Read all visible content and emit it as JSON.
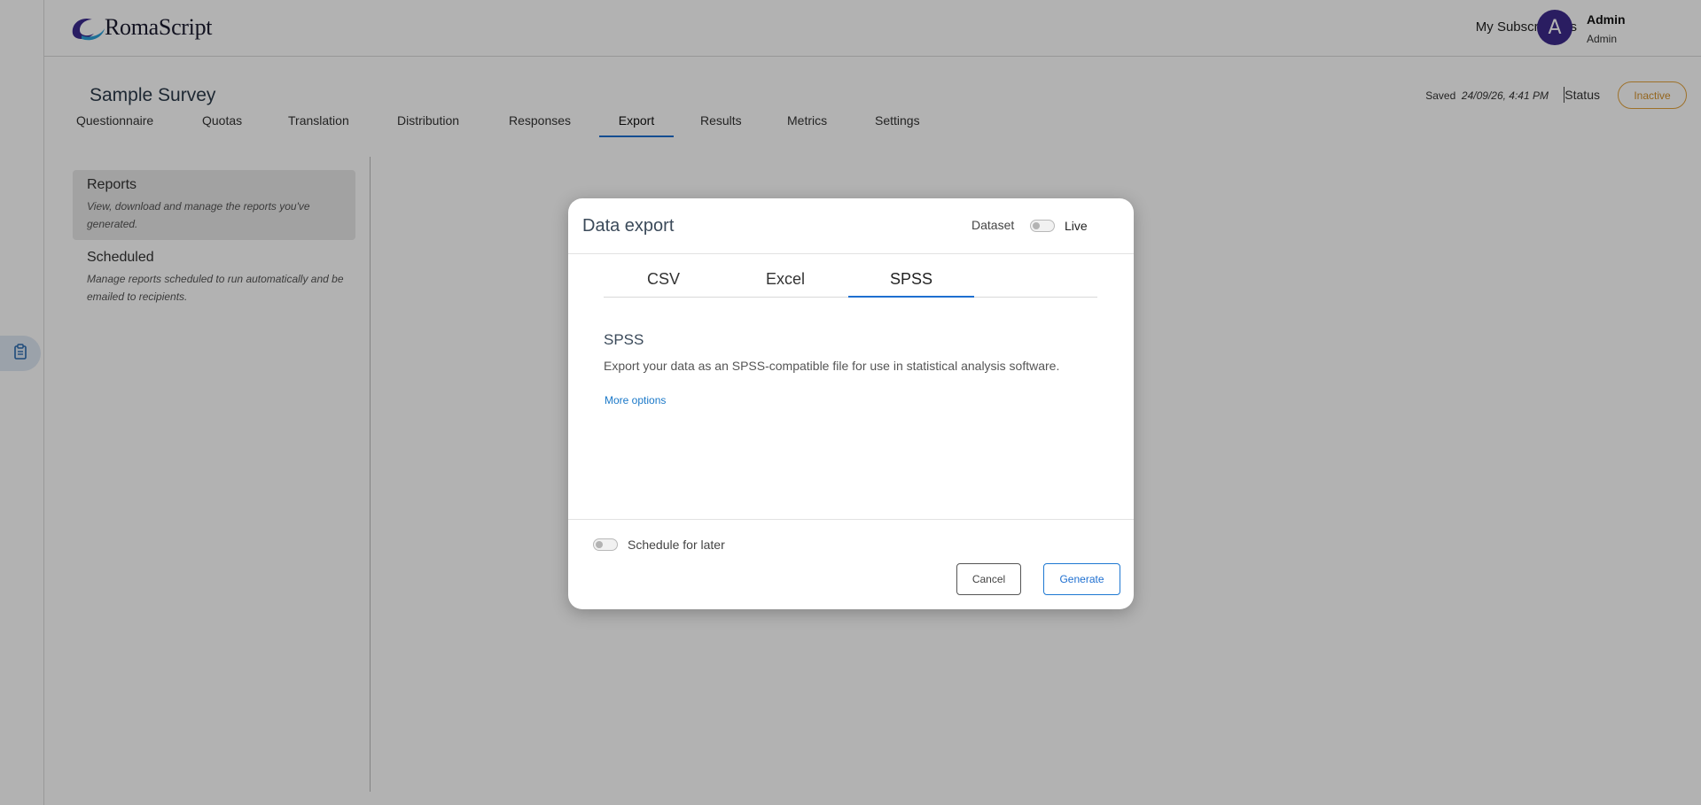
{
  "brand": {
    "name": "RomaScript"
  },
  "header": {
    "subscriptions_link": "My Subscriptions",
    "user": {
      "initial": "A",
      "name": "Admin",
      "role": "Admin"
    }
  },
  "survey": {
    "title": "Sample Survey",
    "saved_label": "Saved",
    "saved_time": "24/09/26, 4:41 PM",
    "status_label": "Status",
    "status_value": "Inactive",
    "status_color": "#e3a33c",
    "tabs": [
      {
        "label": "Questionnaire"
      },
      {
        "label": "Quotas"
      },
      {
        "label": "Translation"
      },
      {
        "label": "Distribution"
      },
      {
        "label": "Responses"
      },
      {
        "label": "Export",
        "active": true
      },
      {
        "label": "Results"
      },
      {
        "label": "Metrics"
      },
      {
        "label": "Settings"
      }
    ]
  },
  "sidebar": {
    "items": [
      {
        "title": "Reports",
        "description": "View, download and manage the reports you've generated.",
        "active": true
      },
      {
        "title": "Scheduled",
        "description": "Manage reports scheduled to run automatically and be emailed to recipients."
      }
    ]
  },
  "rail": {
    "items": [
      {
        "icon": "clipboard-icon",
        "active": true
      }
    ]
  },
  "modal": {
    "title": "Data export",
    "dataset_label": "Dataset",
    "dataset_toggle_on": false,
    "dataset_value": "Live",
    "tabs": [
      {
        "label": "CSV"
      },
      {
        "label": "Excel"
      },
      {
        "label": "SPSS",
        "active": true
      }
    ],
    "section_title": "SPSS",
    "section_description": "Export your data as an SPSS-compatible file for use in statistical analysis software.",
    "more_options": "More options",
    "schedule_label": "Schedule for later",
    "schedule_on": false,
    "cancel_label": "Cancel",
    "generate_label": "Generate",
    "accent_color": "#1e6fd0"
  }
}
